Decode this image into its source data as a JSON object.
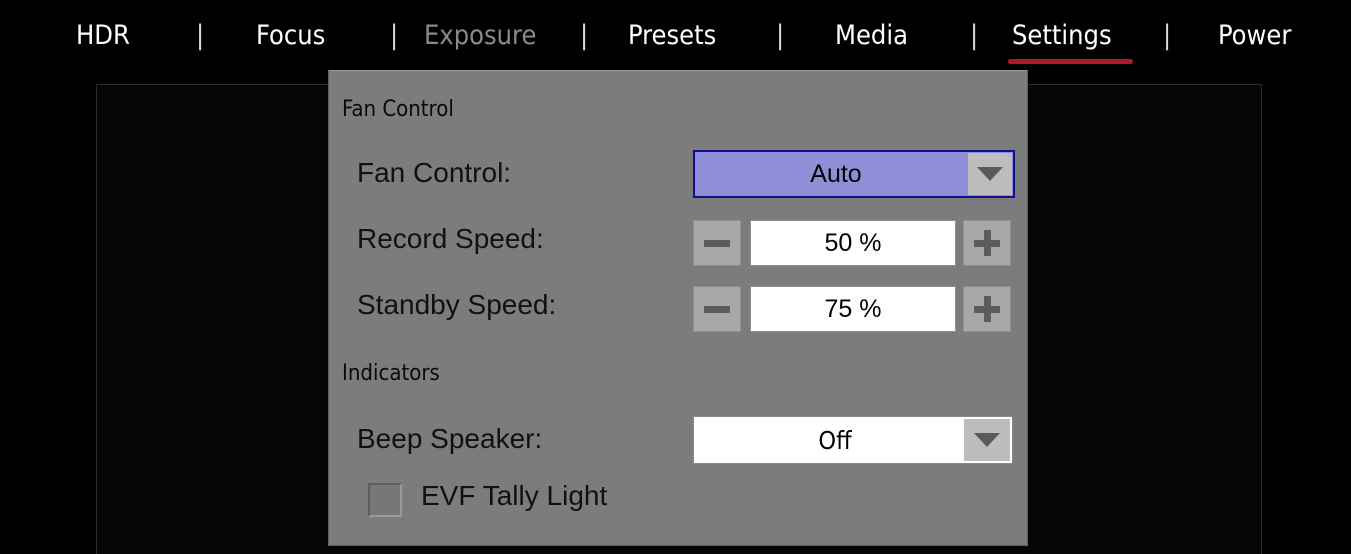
{
  "menu": {
    "items": [
      {
        "label": "HDR",
        "state": "normal"
      },
      {
        "label": "Focus",
        "state": "normal"
      },
      {
        "label": "Exposure",
        "state": "disabled"
      },
      {
        "label": "Presets",
        "state": "normal"
      },
      {
        "label": "Media",
        "state": "normal"
      },
      {
        "label": "Settings",
        "state": "active"
      },
      {
        "label": "Power",
        "state": "normal"
      }
    ],
    "separator": "|",
    "active_underline_color": "#b3182a"
  },
  "panel": {
    "fan_section": {
      "title": "Fan Control",
      "fan_control": {
        "label": "Fan Control:",
        "value": "Auto",
        "arrow_icon": "triangle-down-icon"
      },
      "record_speed": {
        "label": "Record Speed:",
        "value": "50 %",
        "minus_icon": "minus-icon",
        "plus_icon": "plus-icon"
      },
      "standby_speed": {
        "label": "Standby Speed:",
        "value": "75 %",
        "minus_icon": "minus-icon",
        "plus_icon": "plus-icon"
      }
    },
    "indicators_section": {
      "title": "Indicators",
      "beep_speaker": {
        "label": "Beep Speaker:",
        "value": "Off",
        "arrow_icon": "triangle-down-icon"
      },
      "evf_tally_light": {
        "label": "EVF Tally Light",
        "checked": false
      }
    }
  },
  "colors": {
    "panel_bg": "#7c7c7c",
    "selected_field_bg": "#8f8ed6",
    "selected_field_border": "#10108c",
    "disabled_menu_text": "#8a8a8a"
  }
}
